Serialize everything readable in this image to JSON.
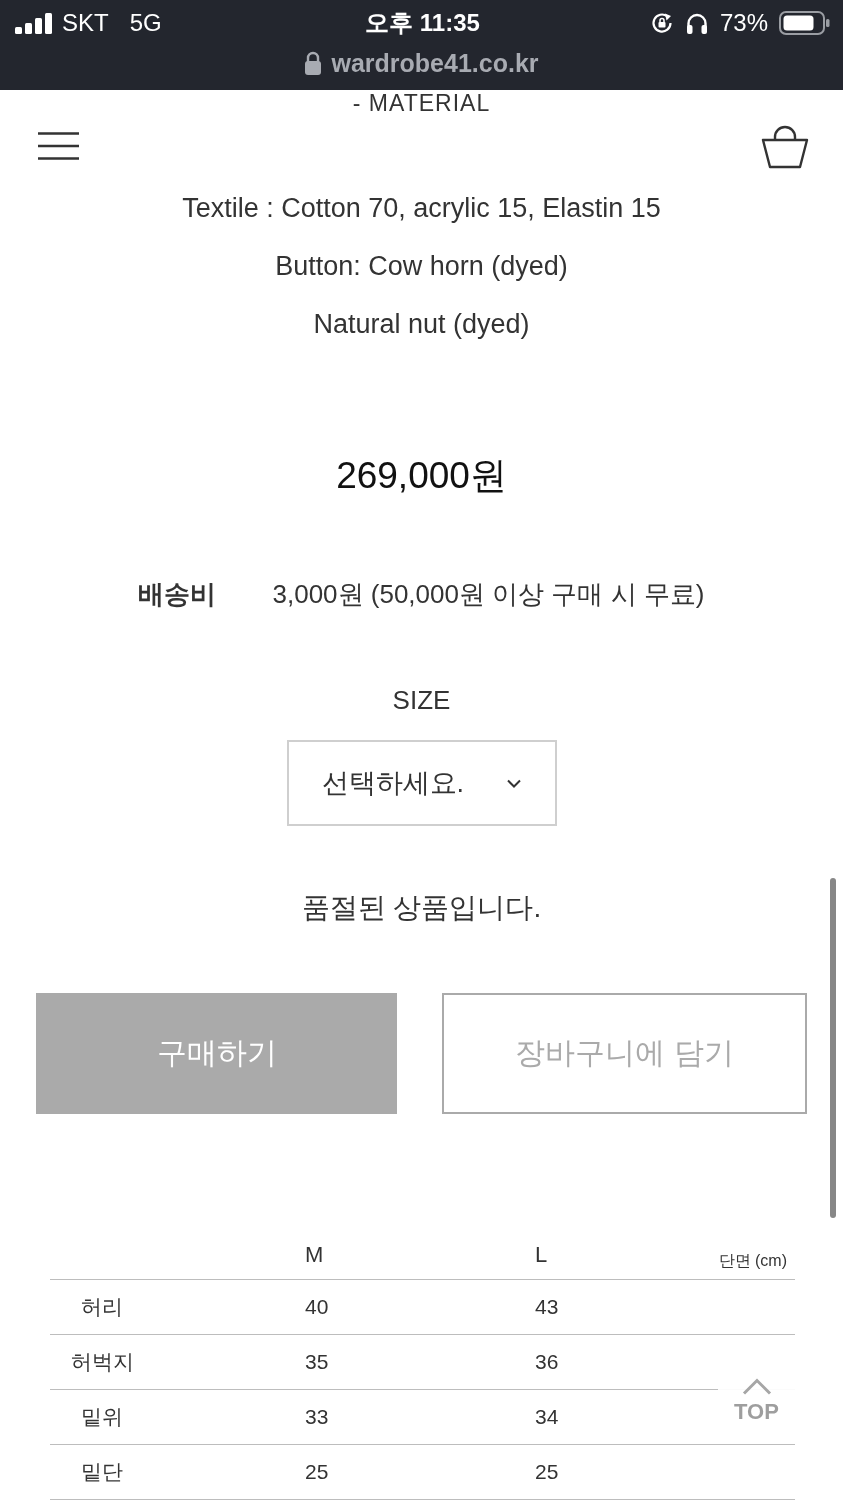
{
  "status_bar": {
    "carrier": "SKT",
    "network": "5G",
    "time": "오후 11:35",
    "battery": "73%",
    "url": "wardrobe41.co.kr"
  },
  "section_heading": "- MATERIAL",
  "material_lines": [
    "Textile : Cotton 70, acrylic 15, Elastin 15",
    "Button: Cow horn (dyed)",
    "Natural nut (dyed)"
  ],
  "price": "269,000원",
  "shipping": {
    "label": "배송비",
    "value": "3,000원 (50,000원 이상 구매 시 무료)"
  },
  "option": {
    "label": "SIZE",
    "value": "선택하세요."
  },
  "stock_notice": "품절된 상품입니다.",
  "buttons": [
    {
      "label": "구매하기",
      "kind": "primary",
      "disabled": true
    },
    {
      "label": "장바구니에 담기",
      "kind": "outline",
      "disabled": true
    }
  ],
  "size_table": {
    "columns": [
      "M",
      "L"
    ],
    "unit_note": "단면 (cm)",
    "rows": [
      {
        "label": "허리",
        "values": [
          "40",
          "43"
        ]
      },
      {
        "label": "허벅지",
        "values": [
          "35",
          "36"
        ]
      },
      {
        "label": "밑위",
        "values": [
          "33",
          "34"
        ]
      },
      {
        "label": "밑단",
        "values": [
          "25",
          "25"
        ]
      }
    ]
  },
  "top_button": {
    "label": "TOP"
  }
}
